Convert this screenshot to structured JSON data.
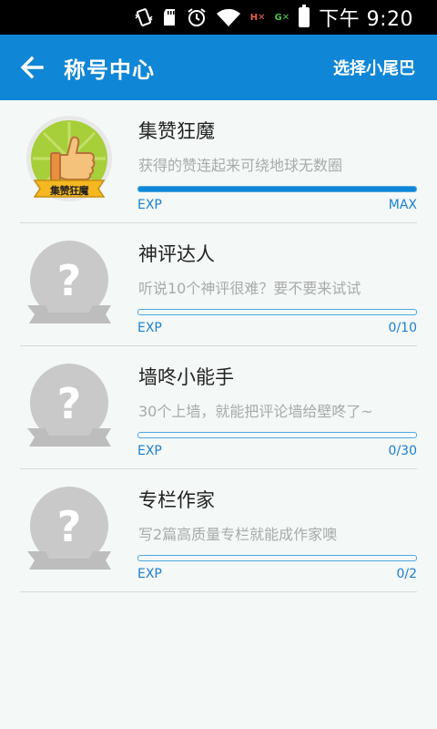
{
  "status_bar": {
    "time": "下午 9:20",
    "icons": [
      "vibrate-icon",
      "sd-card-icon",
      "alarm-icon",
      "wifi-icon",
      "signal-off-icon",
      "signal-g-icon",
      "battery-icon"
    ],
    "signal_1_label": "H",
    "signal_2_label": "G"
  },
  "app_bar": {
    "back_icon": "arrow-left-icon",
    "title": "称号中心",
    "action_label": "选择小尾巴",
    "color": "#0f86d6"
  },
  "titles": [
    {
      "name": "集赞狂魔",
      "description": "获得的赞连起来可绕地球无数圈",
      "exp_label": "EXP",
      "exp_value": "MAX",
      "progress": 1.0,
      "unlocked": true,
      "badge_text": "集赞狂魔"
    },
    {
      "name": "神评达人",
      "description": "听说10个神评很难？要不要来试试",
      "exp_label": "EXP",
      "exp_value": "0/10",
      "progress": 0,
      "unlocked": false
    },
    {
      "name": "墙咚小能手",
      "description": "30个上墙，就能把评论墙给壁咚了~",
      "exp_label": "EXP",
      "exp_value": "0/30",
      "progress": 0,
      "unlocked": false
    },
    {
      "name": "专栏作家",
      "description": "写2篇高质量专栏就能成作家噢",
      "exp_label": "EXP",
      "exp_value": "0/2",
      "progress": 0,
      "unlocked": false
    }
  ]
}
